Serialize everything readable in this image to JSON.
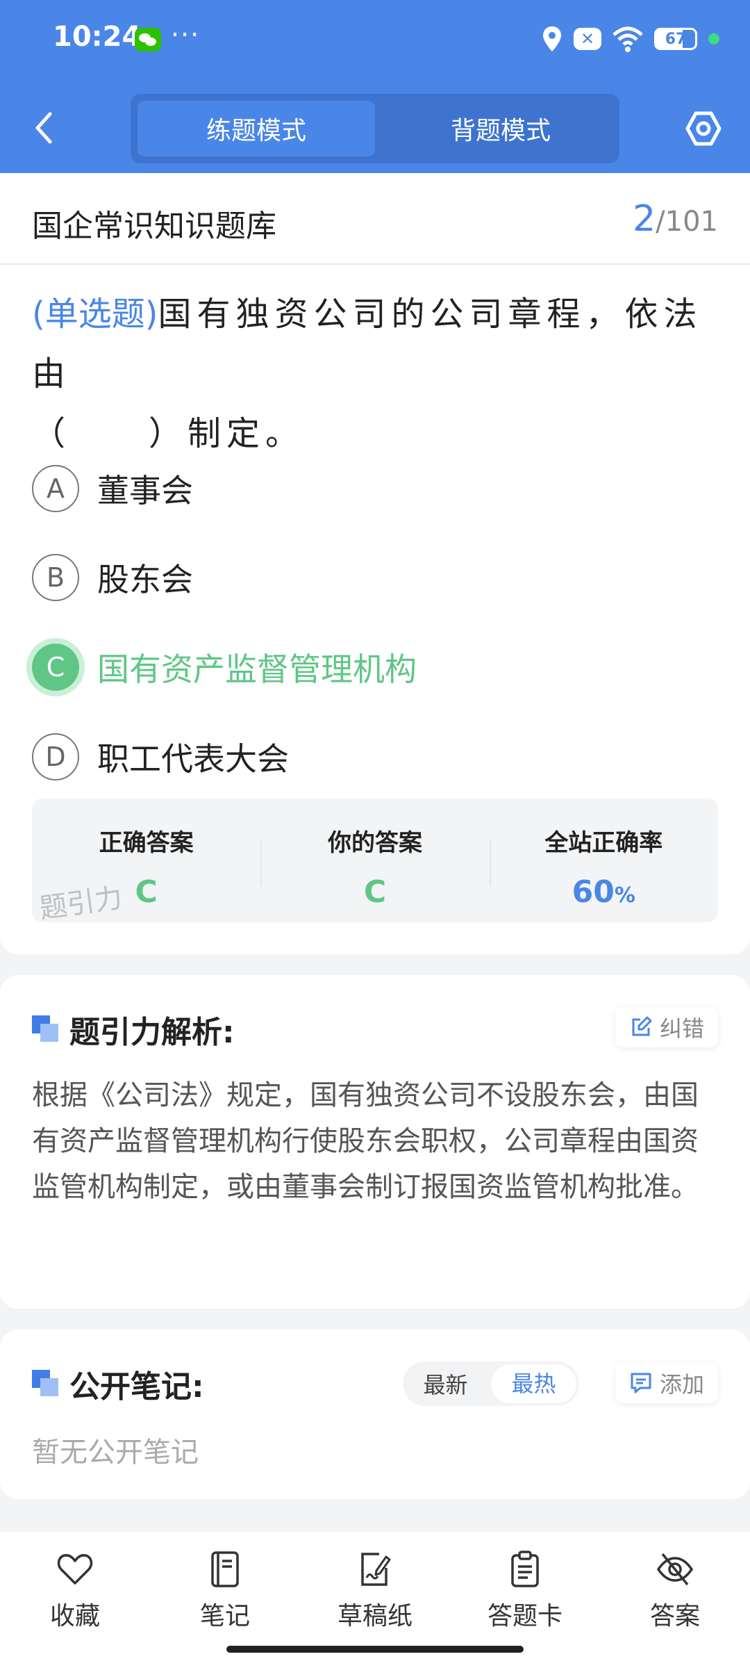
{
  "status_bar": {
    "time": "10:24",
    "dots": "···",
    "battery": "67",
    "battery_level": 0.67,
    "x_badge": "✕"
  },
  "header": {
    "tabs": [
      {
        "label": "练题模式",
        "active": true
      },
      {
        "label": "背题模式",
        "active": false
      }
    ]
  },
  "question": {
    "bank_title": "国企常识知识题库",
    "current": "2",
    "total": "/101",
    "type_label": "(单选题)",
    "stem_line1": "国有独资公司的公司章程，依法由",
    "stem_line2": "（　　）制定。",
    "options": [
      {
        "letter": "A",
        "text": "董事会"
      },
      {
        "letter": "B",
        "text": "股东会"
      },
      {
        "letter": "C",
        "text": "国有资产监督管理机构",
        "correct": true
      },
      {
        "letter": "D",
        "text": "职工代表大会"
      }
    ]
  },
  "answer_summary": {
    "correct_label": "正确答案",
    "correct_value": "C",
    "yours_label": "你的答案",
    "yours_value": "C",
    "rate_label": "全站正确率",
    "rate_value": "60",
    "rate_unit": "%",
    "watermark": "题引力"
  },
  "analysis": {
    "title": "题引力解析:",
    "report_label": "纠错",
    "text": "根据《公司法》规定，国有独资公司不设股东会，由国有资产监督管理机构行使股东会职权，公司章程由国资监管机构制定，或由董事会制订报国资监管机构批准。"
  },
  "notes": {
    "title": "公开笔记:",
    "sort_latest": "最新",
    "sort_hot": "最热",
    "add_label": "添加",
    "empty_text": "暂无公开笔记"
  },
  "bottom_nav": [
    {
      "label": "收藏",
      "icon": "heart-icon"
    },
    {
      "label": "笔记",
      "icon": "notebook-icon"
    },
    {
      "label": "草稿纸",
      "icon": "draft-icon"
    },
    {
      "label": "答题卡",
      "icon": "clipboard-icon"
    },
    {
      "label": "答案",
      "icon": "eye-off-icon"
    }
  ],
  "colors": {
    "primary": "#4a86e8",
    "correct": "#5fc686",
    "header_bg": "#4a86e8"
  }
}
